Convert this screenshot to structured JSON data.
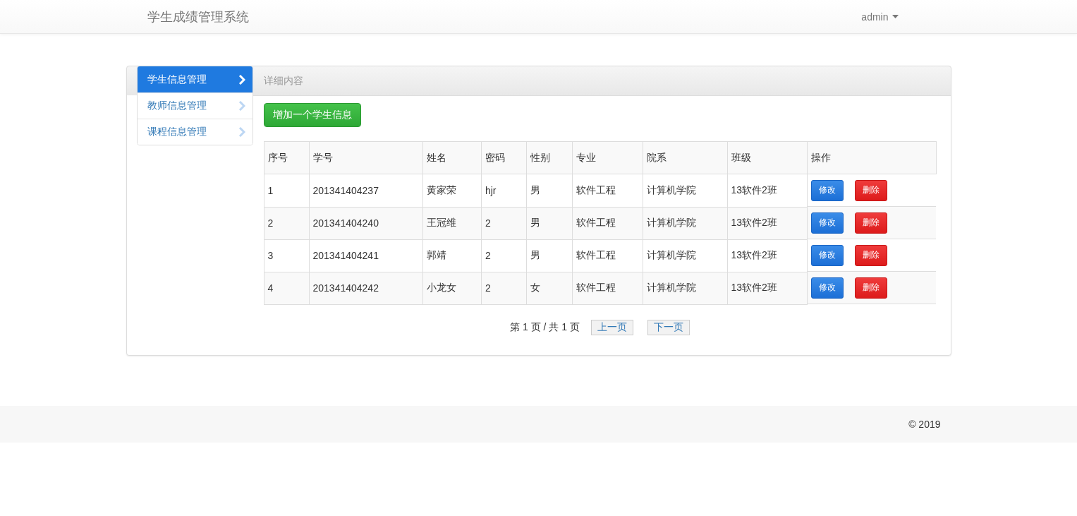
{
  "navbar": {
    "brand": "学生成绩管理系统",
    "user": "admin"
  },
  "sidebar": {
    "items": [
      {
        "label": "学生信息管理",
        "selected": true
      },
      {
        "label": "教师信息管理",
        "selected": false
      },
      {
        "label": "课程信息管理",
        "selected": false
      }
    ]
  },
  "panel": {
    "title": "详细内容",
    "add_button": "增加一个学生信息"
  },
  "table": {
    "columns": [
      "序号",
      "学号",
      "姓名",
      "密码",
      "性别",
      "专业",
      "院系",
      "班级",
      "操作"
    ],
    "rows": [
      {
        "cells": [
          "1",
          "201341404237",
          "黄家荣",
          "hjr",
          "男",
          "软件工程",
          "计算机学院",
          "13软件2班"
        ],
        "edit": "修改",
        "delete": "删除"
      },
      {
        "cells": [
          "2",
          "201341404240",
          "王冠维",
          "2",
          "男",
          "软件工程",
          "计算机学院",
          "13软件2班"
        ],
        "edit": "修改",
        "delete": "删除"
      },
      {
        "cells": [
          "3",
          "201341404241",
          "郭靖",
          "2",
          "男",
          "软件工程",
          "计算机学院",
          "13软件2班"
        ],
        "edit": "修改",
        "delete": "删除"
      },
      {
        "cells": [
          "4",
          "201341404242",
          "小龙女",
          "2",
          "女",
          "软件工程",
          "计算机学院",
          "13软件2班"
        ],
        "edit": "修改",
        "delete": "删除"
      }
    ]
  },
  "pagination": {
    "info": "第 1 页 / 共 1 页",
    "prev": "上一页",
    "next": "下一页"
  },
  "footer": {
    "copyright": "© 2019"
  }
}
